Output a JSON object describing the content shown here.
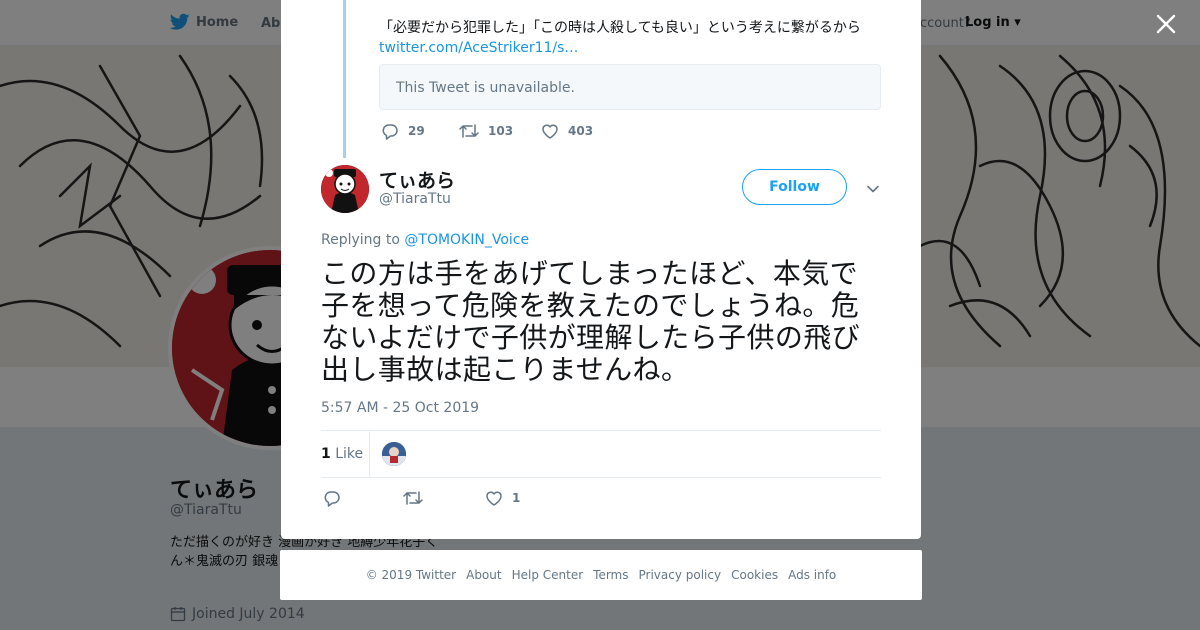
{
  "topbar": {
    "home_label": "Home",
    "about_label": "Abo",
    "account_prompt": "ccount?",
    "login_label": "Log in"
  },
  "profile": {
    "name": "てぃあら",
    "handle": "@TiaraTtu",
    "bio": "ただ描くのが好き 漫画が好き 地縛少年花子くん＊鬼滅の刃 銀魂＊約ネバ＊曇",
    "joined": "Joined July 2014"
  },
  "modal": {
    "parent_tweet": {
      "text": "「必要だから犯罪した」「この時は人殺しても良い」という考えに繋がるから",
      "link": "twitter.com/AceStriker11/s…",
      "unavailable": "This Tweet is unavailable.",
      "replies": "29",
      "retweets": "103",
      "likes": "403"
    },
    "tweet": {
      "author_name": "てぃあら",
      "author_handle": "@TiaraTtu",
      "follow_label": "Follow",
      "replying_prefix": "Replying to",
      "replying_to": "@TOMOKIN_Voice",
      "text": "この方は手をあげてしまったほど、本気で子を想って危険を教えたのでしょうね。危ないよだけで子供が理解したら子供の飛び出し事故は起こりませんね。",
      "timestamp": "5:57 AM - 25 Oct 2019",
      "like_count": "1",
      "like_label": "Like",
      "action_like_count": "1"
    }
  },
  "footer": {
    "items": [
      "© 2019 Twitter",
      "About",
      "Help Center",
      "Terms",
      "Privacy policy",
      "Cookies",
      "Ads info"
    ]
  },
  "colors": {
    "twitter_blue": "#1da1f2",
    "link_blue": "#1b95e0",
    "thread_line": "#9fd0f5",
    "secondary_text": "#657786"
  },
  "icons": {
    "close": "close-icon",
    "reply": "reply-icon",
    "retweet": "retweet-icon",
    "like": "heart-icon",
    "caret": "chevron-down-icon",
    "logo": "twitter-bird-icon",
    "calendar": "calendar-icon"
  }
}
